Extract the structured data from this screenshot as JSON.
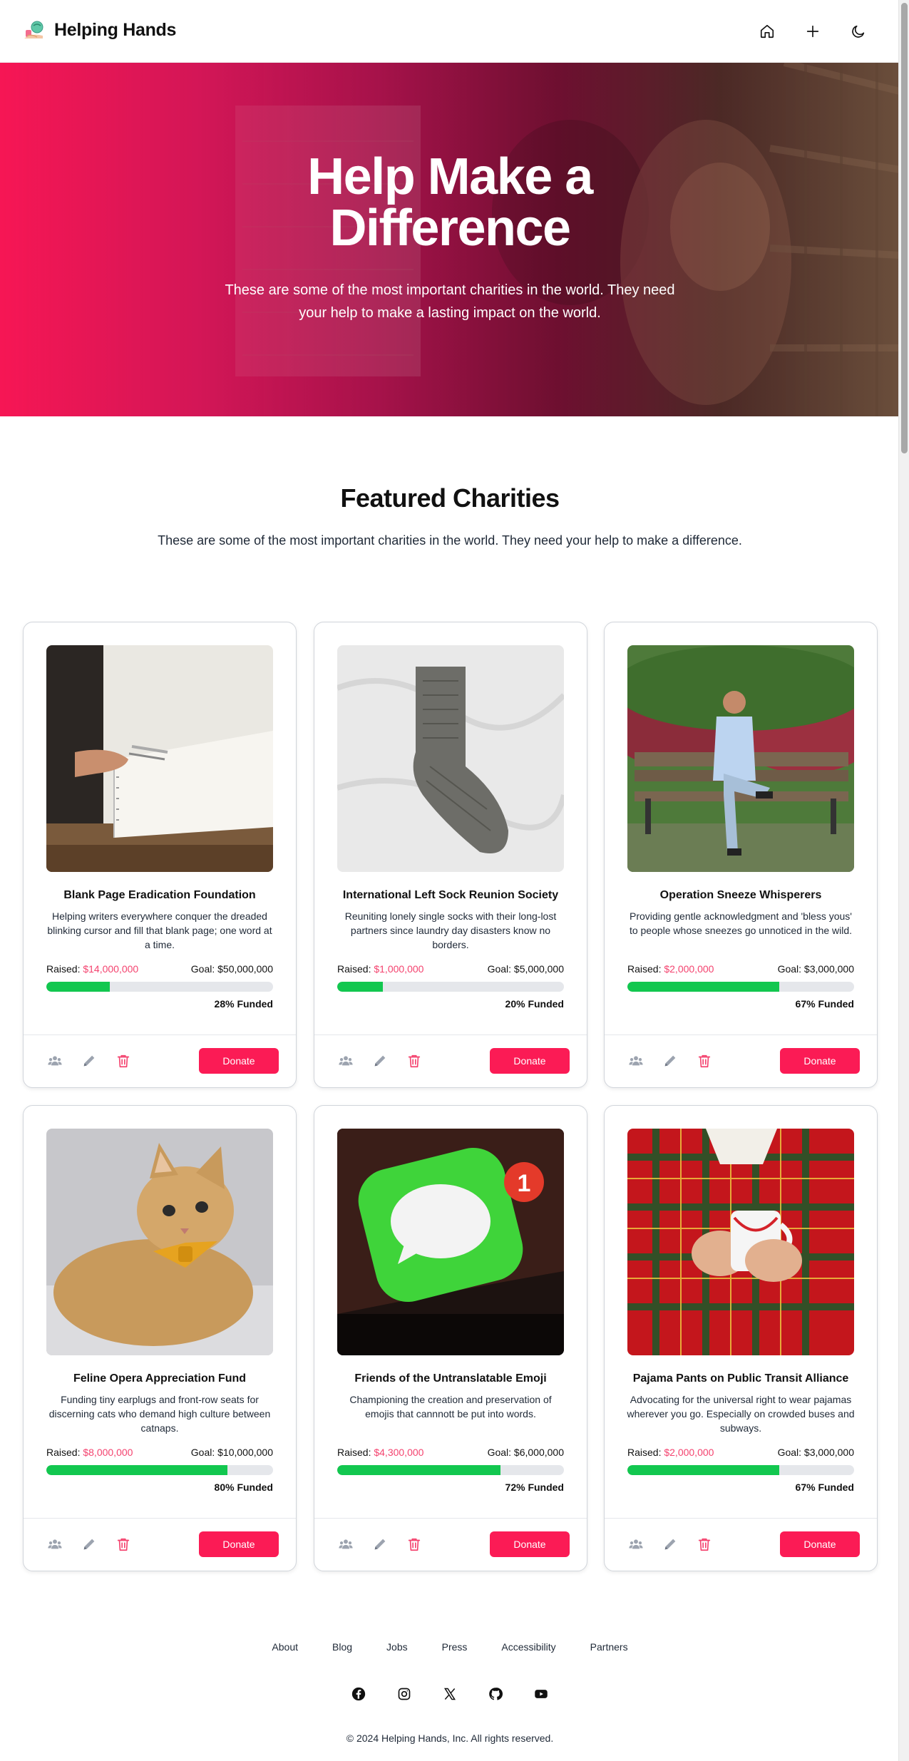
{
  "header": {
    "brand_name": "Helping Hands",
    "icons": [
      "home-icon",
      "plus-icon",
      "moon-icon"
    ]
  },
  "hero": {
    "title": "Help Make a Difference",
    "subtitle": "These are some of the most important charities in the world. They need your help to make a lasting impact on the world."
  },
  "featured": {
    "title": "Featured Charities",
    "subtitle": "These are some of the most important charities in the world. They need your help to make a difference."
  },
  "labels": {
    "raised": "Raised:",
    "goal": "Goal:",
    "donate": "Donate"
  },
  "charities": [
    {
      "title": "Blank Page Eradication Foundation",
      "description": "Helping writers everywhere conquer the dreaded blinking cursor and fill that blank page; one word at a time.",
      "raised": "$14,000,000",
      "goal": "$50,000,000",
      "funded_label": "28% Funded",
      "funded_fraction": 0.28,
      "image": "notebook-photo"
    },
    {
      "title": "International Left Sock Reunion Society",
      "description": "Reuniting lonely single socks with their long-lost partners since laundry day disasters know no borders.",
      "raised": "$1,000,000",
      "goal": "$5,000,000",
      "funded_label": "20% Funded",
      "funded_fraction": 0.2,
      "image": "sock-photo"
    },
    {
      "title": "Operation Sneeze Whisperers",
      "description": "Providing gentle acknowledgment and 'bless yous' to people whose sneezes go unnoticed in the wild.",
      "raised": "$2,000,000",
      "goal": "$3,000,000",
      "funded_label": "67% Funded",
      "funded_fraction": 0.67,
      "image": "park-bench-photo"
    },
    {
      "title": "Feline Opera Appreciation Fund",
      "description": "Funding tiny earplugs and front-row seats for discerning cats who demand high culture between catnaps.",
      "raised": "$8,000,000",
      "goal": "$10,000,000",
      "funded_label": "80% Funded",
      "funded_fraction": 0.8,
      "image": "cat-bowtie-photo"
    },
    {
      "title": "Friends of the Untranslatable Emoji",
      "description": "Championing the creation and preservation of emojis that cannnott be put into words.",
      "raised": "$4,300,000",
      "goal": "$6,000,000",
      "funded_label": "72% Funded",
      "funded_fraction": 0.72,
      "image": "messages-app-photo"
    },
    {
      "title": "Pajama Pants on Public Transit Alliance",
      "description": "Advocating for the universal right to wear pajamas wherever you go. Especially on crowded buses and subways.",
      "raised": "$2,000,000",
      "goal": "$3,000,000",
      "funded_label": "67% Funded",
      "funded_fraction": 0.67,
      "image": "plaid-pajamas-photo"
    }
  ],
  "footer": {
    "links": [
      "About",
      "Blog",
      "Jobs",
      "Press",
      "Accessibility",
      "Partners"
    ],
    "socials": [
      "facebook-icon",
      "instagram-icon",
      "x-icon",
      "github-icon",
      "youtube-icon"
    ],
    "copyright": "© 2024 Helping Hands, Inc. All rights reserved."
  },
  "colors": {
    "accent": "#fb1b55",
    "raised": "#f4436f",
    "progress": "#12c74f"
  }
}
